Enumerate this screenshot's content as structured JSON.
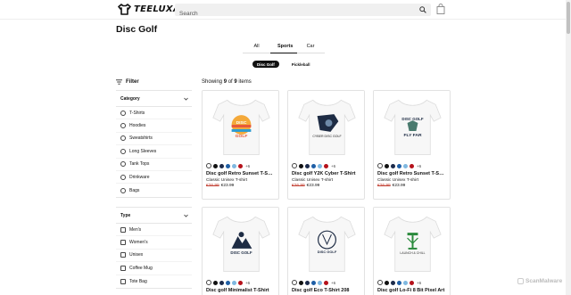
{
  "header": {
    "brand": "TEELUXA",
    "search_placeholder": "Search",
    "icons": {
      "search": "search-icon",
      "bag": "shopping-bag-icon"
    }
  },
  "page": {
    "title": "Disc Golf"
  },
  "tabs": [
    {
      "label": "All",
      "active": false
    },
    {
      "label": "Sports",
      "active": true
    },
    {
      "label": "Car",
      "active": false
    }
  ],
  "chips": [
    {
      "label": "Disc Golf",
      "active": true
    },
    {
      "label": "Pickleball",
      "active": false
    }
  ],
  "filter": {
    "label": "Filter",
    "category": {
      "title": "Category",
      "options": [
        "T-Shirts",
        "Hoodies",
        "Sweatshirts",
        "Long Sleeves",
        "Tank Tops",
        "Drinkware",
        "Bags"
      ]
    },
    "type": {
      "title": "Type",
      "options": [
        "Men's",
        "Women's",
        "Unisex",
        "Coffee Mug",
        "Tote Bag"
      ]
    }
  },
  "results": {
    "prefix": "Showing",
    "shown": "9",
    "of": "of",
    "total": "9",
    "suffix": "items"
  },
  "swatch_colors": [
    "#ffffff",
    "#111111",
    "#1c2a4a",
    "#1f5fa6",
    "#7fb8e0",
    "#b5121b"
  ],
  "products": [
    {
      "name": "Disc golf Retro Sunset T-Shirt",
      "type": "Classic Unisex T-shirt",
      "old_price": "€26.99",
      "price": "€23.99",
      "more": "+6",
      "art": "sunset"
    },
    {
      "name": "Disc golf Y2K Cyber T-Shirt",
      "type": "Classic Unisex T-shirt",
      "old_price": "€26.99",
      "price": "€23.99",
      "more": "+6",
      "art": "cyber"
    },
    {
      "name": "Disc golf Retro Sunset T-Shirt",
      "type": "Classic Unisex T-shirt",
      "old_price": "€26.99",
      "price": "€23.99",
      "more": "+6",
      "art": "flyfar"
    },
    {
      "name": "Disc golf Minimalist T-Shirt",
      "type": "",
      "old_price": "",
      "price": "",
      "more": "+6",
      "art": "mountain"
    },
    {
      "name": "Disc golf Eco T-Shirt 208",
      "type": "",
      "old_price": "",
      "price": "",
      "more": "+6",
      "art": "basket"
    },
    {
      "name": "Disc golf Lo-Fi 8 Bit Pixel Art",
      "type": "",
      "old_price": "",
      "price": "",
      "more": "+6",
      "art": "pixel"
    }
  ],
  "watermark": "ScanMalware"
}
